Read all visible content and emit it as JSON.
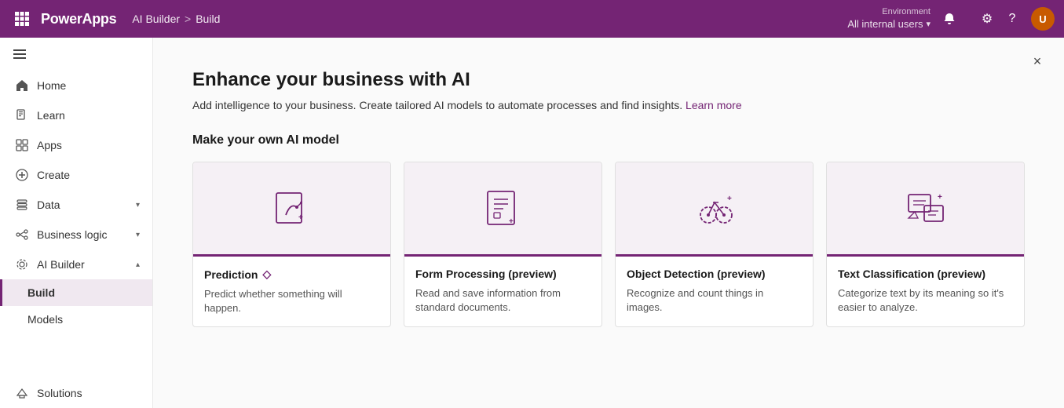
{
  "topbar": {
    "waffle_label": "App launcher",
    "brand": "PowerApps",
    "breadcrumb": [
      "AI Builder",
      "Build"
    ],
    "breadcrumb_sep": ">",
    "env_label": "Environment",
    "env_name": "All internal users",
    "notif_icon": "🔔",
    "settings_icon": "⚙",
    "help_icon": "?",
    "avatar_initials": "U"
  },
  "sidebar": {
    "toggle_label": "Collapse",
    "items": [
      {
        "id": "home",
        "label": "Home",
        "icon": "home"
      },
      {
        "id": "learn",
        "label": "Learn",
        "icon": "learn"
      },
      {
        "id": "apps",
        "label": "Apps",
        "icon": "apps"
      },
      {
        "id": "create",
        "label": "Create",
        "icon": "create"
      },
      {
        "id": "data",
        "label": "Data",
        "icon": "data",
        "expandable": true
      },
      {
        "id": "business-logic",
        "label": "Business logic",
        "icon": "business-logic",
        "expandable": true
      },
      {
        "id": "ai-builder",
        "label": "AI Builder",
        "icon": "ai-builder",
        "expandable": true,
        "expanded": true
      }
    ],
    "sub_items": [
      {
        "id": "build",
        "label": "Build",
        "active": true
      },
      {
        "id": "models",
        "label": "Models"
      }
    ],
    "bottom_items": [
      {
        "id": "solutions",
        "label": "Solutions",
        "icon": "solutions"
      }
    ]
  },
  "content": {
    "close_btn": "×",
    "title": "Enhance your business with AI",
    "subtitle": "Add intelligence to your business. Create tailored AI models to automate processes and find insights.",
    "learn_more_link": "Learn more",
    "section_title": "Make your own AI model",
    "cards": [
      {
        "id": "prediction",
        "title": "Prediction",
        "has_badge": true,
        "badge_icon": "◇",
        "description": "Predict whether something will happen."
      },
      {
        "id": "form-processing",
        "title": "Form Processing (preview)",
        "has_badge": false,
        "description": "Read and save information from standard documents."
      },
      {
        "id": "object-detection",
        "title": "Object Detection (preview)",
        "has_badge": false,
        "description": "Recognize and count things in images."
      },
      {
        "id": "text-classification",
        "title": "Text Classification (preview)",
        "has_badge": false,
        "description": "Categorize text by its meaning so it's easier to analyze."
      }
    ]
  },
  "colors": {
    "brand": "#742474",
    "sidebar_active_border": "#742474"
  }
}
